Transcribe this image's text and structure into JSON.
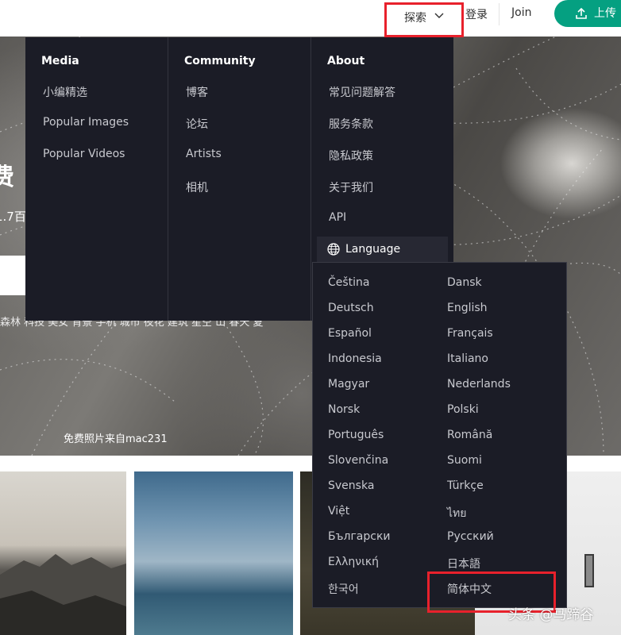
{
  "header": {
    "explore_label": "探索",
    "login_label": "登录",
    "join_label": "Join",
    "upload_label": "上传"
  },
  "hero": {
    "title_fragment": "费",
    "subtitle_fragment": "1.7百",
    "tags_fragment": "森林 科技 美女 背景 手机 城市 夜花 建筑 星空 山 春天 夏",
    "credit": "免费照片来自mac231"
  },
  "mega_menu": {
    "media": {
      "title": "Media",
      "items": [
        "小编精选",
        "Popular Images",
        "Popular Videos"
      ]
    },
    "community": {
      "title": "Community",
      "items": [
        "博客",
        "论坛",
        "Artists",
        "相机"
      ]
    },
    "about": {
      "title": "About",
      "items": [
        "常见问题解答",
        "服务条款",
        "隐私政策",
        "关于我们",
        "API"
      ]
    },
    "language_label": "Language"
  },
  "languages": {
    "left": [
      "Čeština",
      "Deutsch",
      "Español",
      "Indonesia",
      "Magyar",
      "Norsk",
      "Português",
      "Slovenčina",
      "Svenska",
      "Việt",
      "Български",
      "Ελληνική",
      "한국어"
    ],
    "right": [
      "Dansk",
      "English",
      "Français",
      "Italiano",
      "Nederlands",
      "Polski",
      "Română",
      "Suomi",
      "Türkçe",
      "ไทย",
      "Русский",
      "日本語",
      "简体中文"
    ]
  },
  "watermark": "头条 @马蹄谷",
  "colors": {
    "accent": "#05a081",
    "menu_bg": "#1b1c26",
    "highlight_box": "#e8212c"
  },
  "icons": [
    "chevron-down-icon",
    "upload-icon",
    "globe-icon"
  ]
}
